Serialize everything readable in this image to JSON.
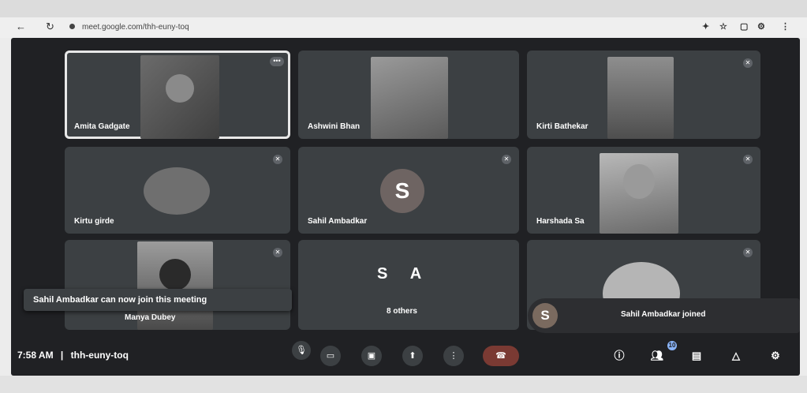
{
  "browser": {
    "tab_text": "",
    "url": "meet.google.com/thh-euny-toq",
    "back_icon": "back-arrow-icon",
    "reload_icon": "reload-icon"
  },
  "tiles": [
    {
      "name": "Amita Gadgate",
      "active": true
    },
    {
      "name": "Ashwini Bhan"
    },
    {
      "name": "Kirti Bathekar"
    },
    {
      "name": "Kirtu girde"
    },
    {
      "name": "Sahil Ambadkar",
      "initial": "S"
    },
    {
      "name": "Harshada Sa"
    },
    {
      "name": "Manya Dubey"
    },
    {
      "name": "8 others",
      "initials": "S  A"
    },
    {
      "name": ""
    }
  ],
  "toast": "Sahil Ambadkar can now join this meeting",
  "join_notice": {
    "initial": "S",
    "message": "Sahil Ambadkar joined"
  },
  "bottom_bar": {
    "time": "7:58 AM",
    "separator": "|",
    "meeting_code": "thh-euny-toq",
    "participants_badge": "10"
  },
  "colors": {
    "meet_bg": "#202124",
    "tile_bg": "#3c4043",
    "end_call": "#7a3a33"
  }
}
